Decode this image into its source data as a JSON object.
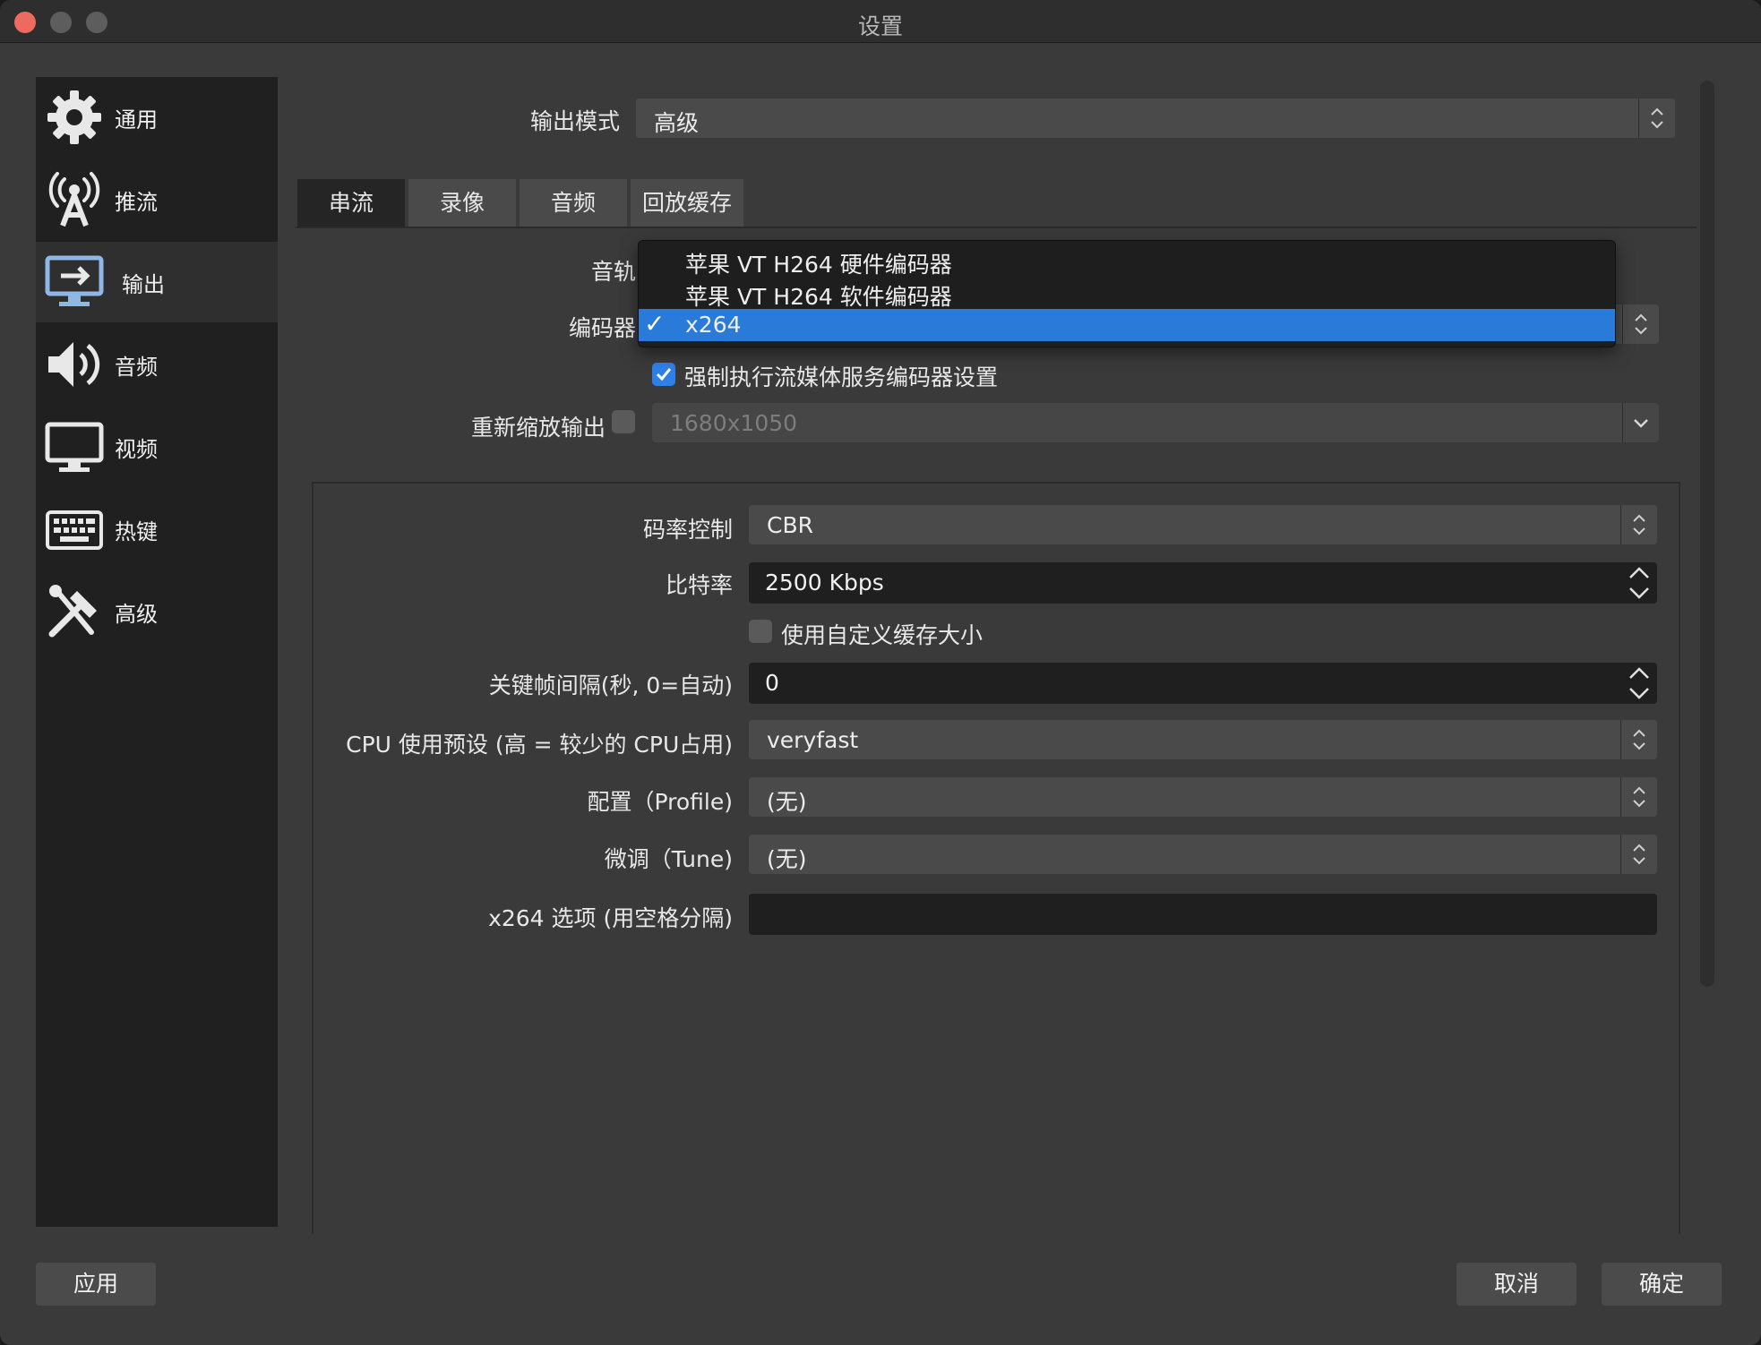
{
  "window": {
    "title": "设置"
  },
  "sidebar": {
    "items": [
      {
        "label": "通用",
        "icon": "gear-icon"
      },
      {
        "label": "推流",
        "icon": "broadcast-antenna-icon"
      },
      {
        "label": "输出",
        "icon": "output-monitor-icon",
        "active": true
      },
      {
        "label": "音频",
        "icon": "speaker-icon"
      },
      {
        "label": "视频",
        "icon": "display-icon"
      },
      {
        "label": "热键",
        "icon": "keyboard-icon"
      },
      {
        "label": "高级",
        "icon": "tools-icon"
      }
    ]
  },
  "output_mode": {
    "label": "输出模式",
    "value": "高级"
  },
  "tabs": [
    {
      "label": "串流",
      "active": true
    },
    {
      "label": "录像"
    },
    {
      "label": "音频"
    },
    {
      "label": "回放缓存"
    }
  ],
  "stream": {
    "audio_track_label": "音轨",
    "encoder_label": "编码器",
    "encoder_options": [
      {
        "label": "苹果 VT H264 硬件编码器"
      },
      {
        "label": "苹果 VT H264 软件编码器"
      },
      {
        "label": "x264",
        "selected": true
      }
    ],
    "encoder_check_mark": "✓",
    "enforce_label": "强制执行流媒体服务编码器设置",
    "enforce_checked": true,
    "rescale_label": "重新缩放输出",
    "rescale_checked": false,
    "rescale_value": "1680x1050"
  },
  "encoder_settings": {
    "rate_control_label": "码率控制",
    "rate_control_value": "CBR",
    "bitrate_label": "比特率",
    "bitrate_value": "2500 Kbps",
    "custom_buffer_label": "使用自定义缓存大小",
    "custom_buffer_checked": false,
    "keyframe_label": "关键帧间隔(秒, 0=自动)",
    "keyframe_value": "0",
    "cpu_preset_label": "CPU 使用预设 (高 = 较少的 CPU占用)",
    "cpu_preset_value": "veryfast",
    "profile_label": "配置（Profile)",
    "profile_value": "(无)",
    "tune_label": "微调（Tune)",
    "tune_value": "(无)",
    "x264_options_label": "x264 选项 (用空格分隔)",
    "x264_options_value": ""
  },
  "buttons": {
    "apply": "应用",
    "cancel": "取消",
    "ok": "确定"
  },
  "colors": {
    "accent": "#2a7bd9",
    "window_bg": "#3a3a3a",
    "sidebar_bg": "#202020"
  }
}
